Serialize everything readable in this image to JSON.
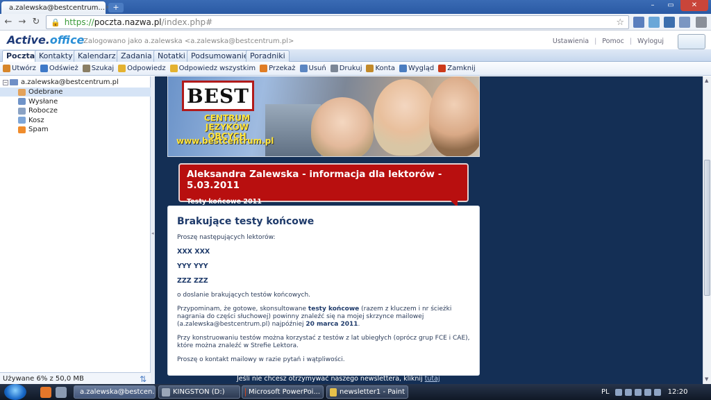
{
  "browser": {
    "tab_title": "a.zalewska@bestcentrum...",
    "tab_close": "×",
    "new_tab": "+",
    "url_https": "https://",
    "url_host": "poczta.nazwa.pl",
    "url_path": "/index.php#",
    "back": "←",
    "forward": "→",
    "reload": "↻",
    "star": "☆",
    "window_min": "–",
    "window_max": "▭",
    "window_close": "✕"
  },
  "app": {
    "logo_main": "Active.",
    "logo_sub": "office",
    "logged_in": "Zalogowano jako a.zalewska <a.zalewska@bestcentrum.pl>",
    "links": [
      "Ustawienia",
      "Pomoc",
      "Wyloguj"
    ],
    "link_sep": "|"
  },
  "tabs": [
    "Poczta",
    "Kontakty",
    "Kalendarz",
    "Zadania",
    "Notatki",
    "Podsumowanie",
    "Poradniki"
  ],
  "toolbar": [
    {
      "label": "Utwórz",
      "icon": "compose-icon",
      "color": "#d7862a"
    },
    {
      "label": "Odśwież",
      "icon": "refresh-icon",
      "color": "#3e79c8"
    },
    {
      "label": "Szukaj",
      "icon": "search-icon",
      "color": "#8a7e64"
    },
    {
      "label": "Odpowiedz",
      "icon": "reply-icon",
      "color": "#e4b230"
    },
    {
      "label": "Odpowiedz wszystkim",
      "icon": "reply-all-icon",
      "color": "#e4b230"
    },
    {
      "label": "Przekaż",
      "icon": "forward-icon",
      "color": "#e07d25"
    },
    {
      "label": "Usuń",
      "icon": "trash-icon",
      "color": "#5b86c2"
    },
    {
      "label": "Drukuj",
      "icon": "print-icon",
      "color": "#7c8796"
    },
    {
      "label": "Konta",
      "icon": "wrench-icon",
      "color": "#c28a2a"
    },
    {
      "label": "Wygląd",
      "icon": "layout-icon",
      "color": "#4b7dc0"
    },
    {
      "label": "Zamknij",
      "icon": "close-icon",
      "color": "#cc3a1a"
    }
  ],
  "sidebar": {
    "account": "a.zalewska@bestcentrum.pl",
    "folders": [
      {
        "label": "Odebrane",
        "icon": "inbox-icon",
        "color": "#e3a25a",
        "selected": true
      },
      {
        "label": "Wysłane",
        "icon": "sent-icon",
        "color": "#6f93c8",
        "selected": false
      },
      {
        "label": "Robocze",
        "icon": "drafts-icon",
        "color": "#8aa2c4",
        "selected": false
      },
      {
        "label": "Kosz",
        "icon": "trash-icon",
        "color": "#7ea6d8",
        "selected": false
      },
      {
        "label": "Spam",
        "icon": "spam-icon",
        "color": "#f08c2c",
        "selected": false
      }
    ],
    "quota": "Używane 6% z 50,0 MB"
  },
  "message": {
    "banner_logo": "BEST",
    "banner_sub1": "CENTRUM",
    "banner_sub2": "JĘZYKÓW OBCYCH",
    "banner_url": "www.bestcentrum.pl",
    "red_title": "Aleksandra Zalewska - informacja dla lektorów - 5.03.2011",
    "red_subtitle": "Testy końcowe 2011",
    "heading": "Brakujące testy końcowe",
    "intro": "Proszę następujących lektorów:",
    "names": [
      "XXX XXX",
      "YYY YYY",
      "ZZZ ZZZ"
    ],
    "p1": "o doslanie brakujących testów końcowych.",
    "p2_a": "Przypominam, że gotowe, skonsultowane ",
    "p2_b": "testy końcowe",
    "p2_c": " (razem z kluczem i nr ścieżki nagrania do części słuchowej) powinny znaleźć się na mojej skrzynce mailowej (a.zalewska@bestcentrum.pl) najpóźniej ",
    "p2_d": "20 marca 2011",
    "p2_e": ".",
    "p3": "Przy konstruowaniu testów można korzystać z testów z lat ubiegłych (oprócz grup FCE i CAE), które można znaleźć w Strefie Lektora.",
    "p4": "Proszę o kontakt mailowy w razie pytań i wątpliwości.",
    "unsub_text": "Jeśli nie chcesz otrzymywać naszego newslettera, kliknij ",
    "unsub_link": "tutaj"
  },
  "taskbar": {
    "tasks": [
      {
        "label": "a.zalewska@bestcen...",
        "color": "#e9a32a",
        "active": true
      },
      {
        "label": "KINGSTON (D:)",
        "color": "#9aa6b8",
        "active": false
      },
      {
        "label": "Microsoft PowerPoi...",
        "color": "#d1461f",
        "active": false
      },
      {
        "label": "newsletter1 - Paint",
        "color": "#e6c04a",
        "active": false
      }
    ],
    "lang": "PL",
    "clock": "12:20"
  }
}
